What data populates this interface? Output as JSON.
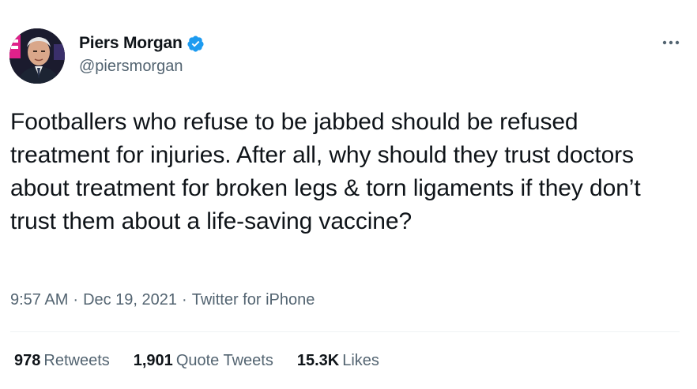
{
  "author": {
    "name": "Piers Morgan",
    "handle": "@piersmorgan",
    "verified": true
  },
  "tweet": {
    "text": "Footballers who refuse to be jabbed should be refused treatment for injuries. After all, why should they trust doctors about treatment for broken legs & torn ligaments if they don’t trust them about a life-saving vaccine?",
    "time": "9:57 AM",
    "date": "Dec 19, 2021",
    "source": "Twitter for iPhone",
    "separator": "·"
  },
  "stats": {
    "retweets": {
      "count": "978",
      "label": "Retweets"
    },
    "quote_tweets": {
      "count": "1,901",
      "label": "Quote Tweets"
    },
    "likes": {
      "count": "15.3K",
      "label": "Likes"
    }
  },
  "icons": {
    "verified": "verified-badge-icon",
    "more": "more-horizontal-icon"
  },
  "colors": {
    "text_primary": "#0f1419",
    "text_secondary": "#536471",
    "verified_blue": "#1d9bf0",
    "divider": "#eff3f4"
  }
}
